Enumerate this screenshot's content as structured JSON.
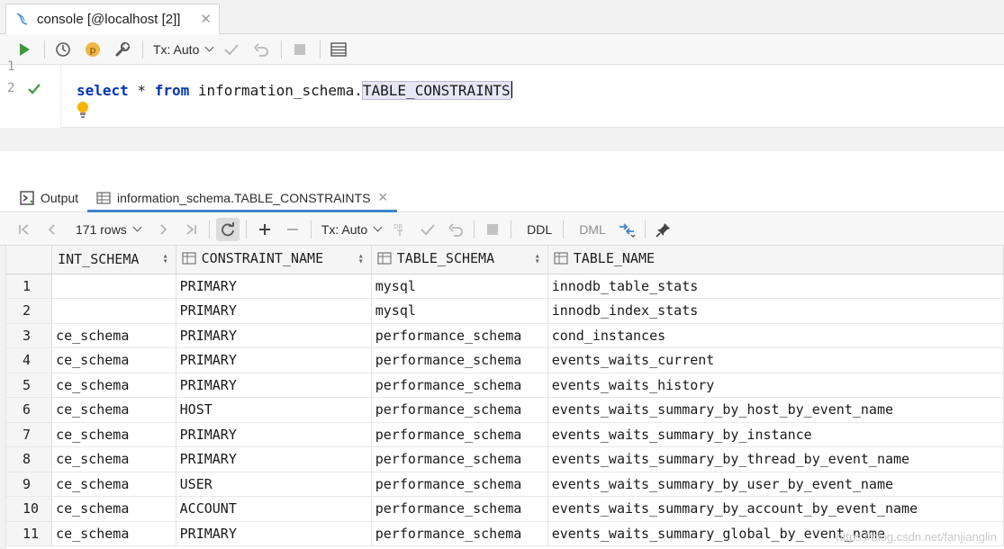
{
  "editor_tab": {
    "title": "console [@localhost [2]]"
  },
  "toolbar": {
    "tx_label": "Tx: Auto"
  },
  "editor": {
    "line1": "1",
    "line2": "2",
    "kw_select": "select",
    "star": " * ",
    "kw_from": "from",
    "schema": " information_schema.",
    "table": "TABLE_CONSTRAINTS"
  },
  "results_tabs": [
    {
      "label": "Output"
    },
    {
      "label": "information_schema.TABLE_CONSTRAINTS"
    }
  ],
  "results_toolbar": {
    "rows": "171 rows",
    "tx_label": "Tx: Auto",
    "ddl": "DDL",
    "dml": "DML"
  },
  "grid": {
    "columns": [
      "INT_SCHEMA",
      "CONSTRAINT_NAME",
      "TABLE_SCHEMA",
      "TABLE_NAME"
    ],
    "rows": [
      {
        "n": "1",
        "c0": "",
        "c1": "PRIMARY",
        "c2": "mysql",
        "c3": "innodb_table_stats"
      },
      {
        "n": "2",
        "c0": "",
        "c1": "PRIMARY",
        "c2": "mysql",
        "c3": "innodb_index_stats"
      },
      {
        "n": "3",
        "c0": "ce_schema",
        "c1": "PRIMARY",
        "c2": "performance_schema",
        "c3": "cond_instances"
      },
      {
        "n": "4",
        "c0": "ce_schema",
        "c1": "PRIMARY",
        "c2": "performance_schema",
        "c3": "events_waits_current"
      },
      {
        "n": "5",
        "c0": "ce_schema",
        "c1": "PRIMARY",
        "c2": "performance_schema",
        "c3": "events_waits_history"
      },
      {
        "n": "6",
        "c0": "ce_schema",
        "c1": "HOST",
        "c2": "performance_schema",
        "c3": "events_waits_summary_by_host_by_event_name"
      },
      {
        "n": "7",
        "c0": "ce_schema",
        "c1": "PRIMARY",
        "c2": "performance_schema",
        "c3": "events_waits_summary_by_instance"
      },
      {
        "n": "8",
        "c0": "ce_schema",
        "c1": "PRIMARY",
        "c2": "performance_schema",
        "c3": "events_waits_summary_by_thread_by_event_name"
      },
      {
        "n": "9",
        "c0": "ce_schema",
        "c1": "USER",
        "c2": "performance_schema",
        "c3": "events_waits_summary_by_user_by_event_name"
      },
      {
        "n": "10",
        "c0": "ce_schema",
        "c1": "ACCOUNT",
        "c2": "performance_schema",
        "c3": "events_waits_summary_by_account_by_event_name"
      },
      {
        "n": "11",
        "c0": "ce_schema",
        "c1": "PRIMARY",
        "c2": "performance_schema",
        "c3": "events_waits_summary_global_by_event_name"
      }
    ]
  },
  "watermark": "https://blog.csdn.net/fanjianglin",
  "colors": {
    "accent": "#4083c9",
    "run": "#3a9a3a",
    "keyword": "#0033b3"
  }
}
